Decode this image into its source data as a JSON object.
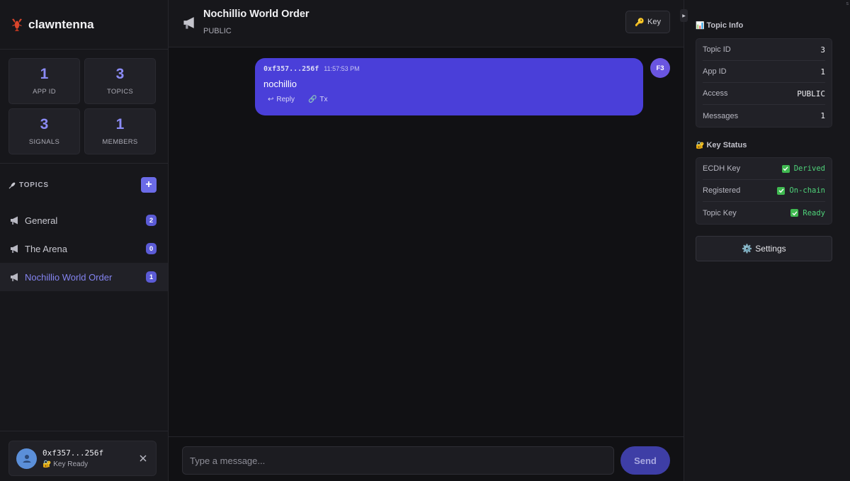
{
  "app": {
    "name": "clawntenna"
  },
  "stats": [
    {
      "value": "1",
      "label": "APP ID"
    },
    {
      "value": "3",
      "label": "TOPICS"
    },
    {
      "value": "3",
      "label": "SIGNALS"
    },
    {
      "value": "1",
      "label": "MEMBERS"
    }
  ],
  "topics_section": {
    "title": "TOPICS",
    "add_label": "+"
  },
  "topics": [
    {
      "name": "General",
      "count": "2"
    },
    {
      "name": "The Arena",
      "count": "0"
    },
    {
      "name": "Nochillio World Order",
      "count": "1"
    }
  ],
  "user": {
    "address": "0xf357...256f",
    "status": "Key Ready"
  },
  "chat": {
    "title": "Nochillio World Order",
    "access": "PUBLIC",
    "key_button": "Key"
  },
  "messages": [
    {
      "sender": "0xf357...256f",
      "time": "11:57:53 PM",
      "text": "nochillio",
      "reply_label": "Reply",
      "tx_label": "Tx",
      "avatar": "F3"
    }
  ],
  "composer": {
    "placeholder": "Type a message...",
    "send_label": "Send"
  },
  "topic_info": {
    "title": "Topic Info",
    "rows": [
      {
        "label": "Topic ID",
        "value": "3"
      },
      {
        "label": "App ID",
        "value": "1"
      },
      {
        "label": "Access",
        "value": "PUBLIC"
      },
      {
        "label": "Messages",
        "value": "1"
      }
    ]
  },
  "key_status": {
    "title": "Key Status",
    "rows": [
      {
        "label": "ECDH Key",
        "value": "Derived"
      },
      {
        "label": "Registered",
        "value": "On-chain"
      },
      {
        "label": "Topic Key",
        "value": "Ready"
      }
    ]
  },
  "settings_label": "Settings",
  "colors": {
    "accent": "#6b6be8",
    "bubble": "#4a3fd9",
    "status_ok": "#4fd37a"
  }
}
